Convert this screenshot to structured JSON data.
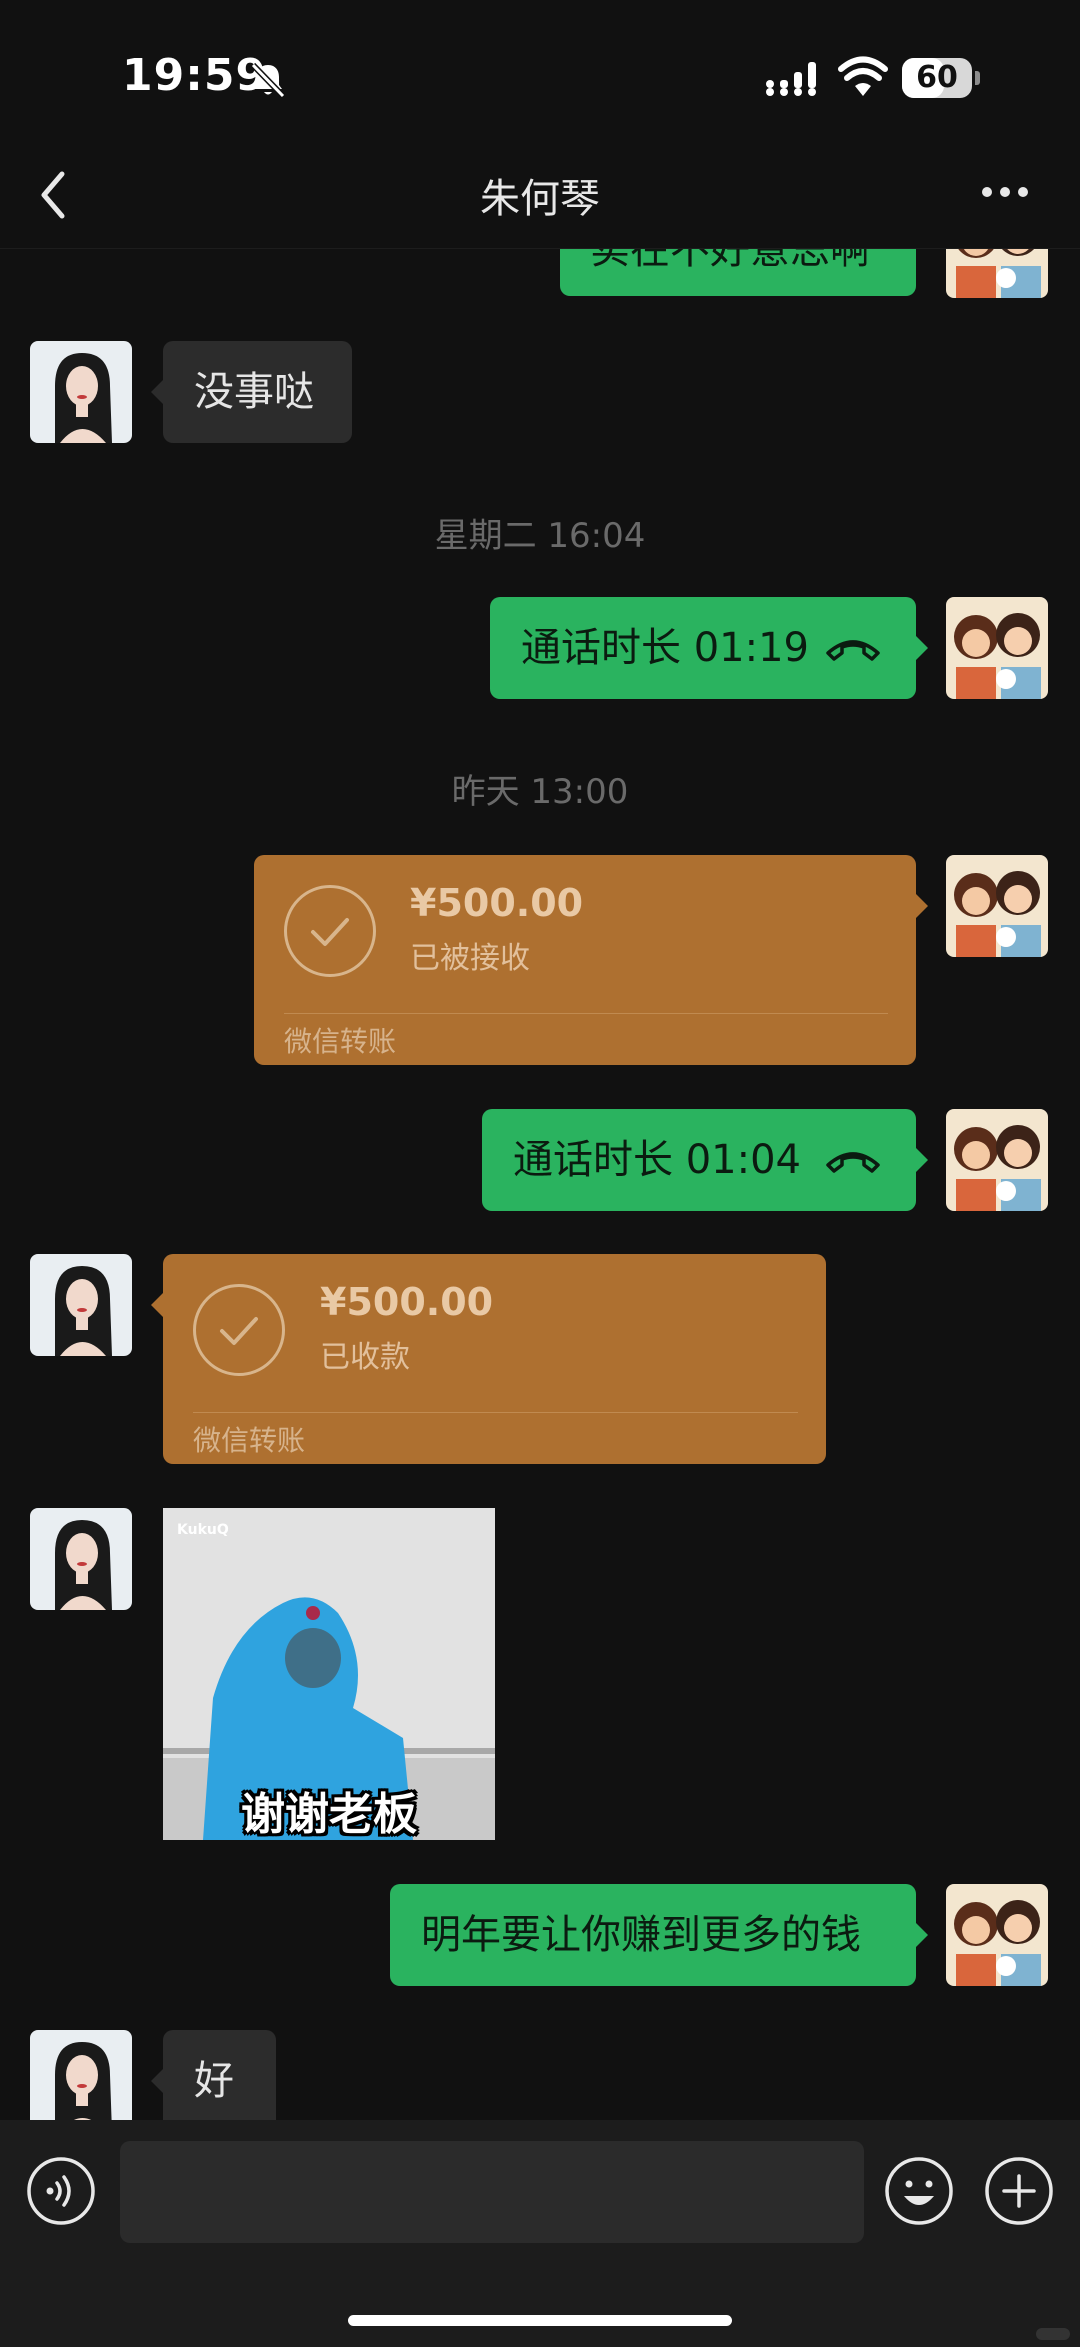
{
  "status_bar": {
    "time": "19:59",
    "battery": "60",
    "battery_percent": 60
  },
  "header": {
    "title": "朱何琴"
  },
  "messages": {
    "partial_top": "实在不好意思啊",
    "reply_1": "没事哒",
    "timestamp_1": "星期二 16:04",
    "call_1": "通话时长 01:19",
    "timestamp_2": "昨天 13:00",
    "transfer_1": {
      "amount": "¥500.00",
      "status": "已被接收",
      "footer": "微信转账"
    },
    "call_2": "通话时长 01:04",
    "transfer_2": {
      "amount": "¥500.00",
      "status": "已收款",
      "footer": "微信转账"
    },
    "sticker_caption": "谢谢老板",
    "sticker_watermark": "KukuQ",
    "outgoing_3": "明年要让你赚到更多的钱",
    "reply_2": "好"
  },
  "input": {
    "placeholder": ""
  },
  "icons": {
    "back": "chevron-left-icon",
    "more": "more-dots-icon",
    "mute": "bell-slash-icon",
    "voice": "voice-icon",
    "emoji": "emoji-icon",
    "plus": "plus-icon",
    "call": "phone-hangup-icon"
  },
  "colors": {
    "background": "#111111",
    "green_bubble": "#2ab35f",
    "gray_bubble": "#2c2c2c",
    "transfer_bubble": "#ae7030",
    "bottom_bar": "#1c1c1c"
  }
}
